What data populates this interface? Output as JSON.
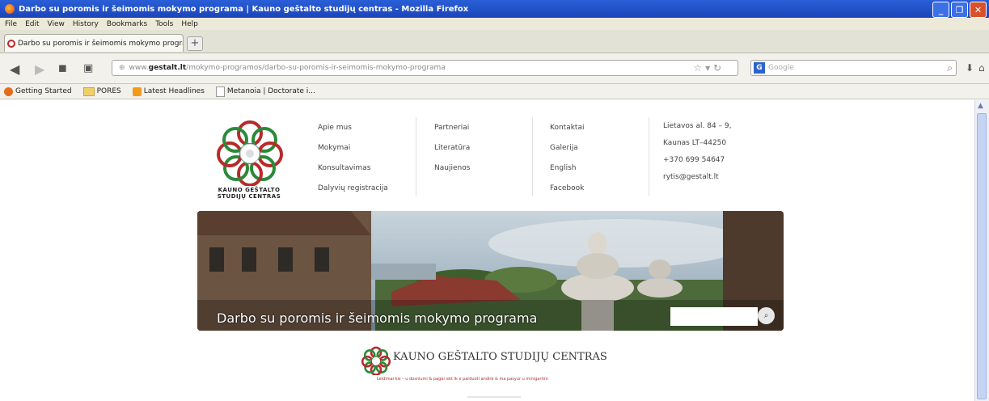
{
  "window": {
    "title": "Darbo su poromis ir šeimomis mokymo programa | Kauno geštalto studijų centras - Mozilla Firefox"
  },
  "menu": [
    "File",
    "Edit",
    "View",
    "History",
    "Bookmarks",
    "Tools",
    "Help"
  ],
  "tab": {
    "label": "Darbo su poromis ir šeimomis mokymo progra..."
  },
  "address": {
    "prefix": "www.",
    "domain": "gestalt.lt",
    "path": "/mokymo-programos/darbo-su-poromis-ir-seimomis-mokymo-programa"
  },
  "search": {
    "engine": "G",
    "placeholder": "Google"
  },
  "bookmarks": [
    "Getting Started",
    "PORES",
    "Latest Headlines",
    "Metanoia | Doctorate i..."
  ],
  "site": {
    "logo_line1": "KAUNO GEŠTALTO",
    "logo_line2": "STUDIJŲ CENTRAS",
    "nav_col1": [
      "Apie mus",
      "Mokymai",
      "Konsultavimas",
      "Dalyvių registracija"
    ],
    "nav_col2": [
      "Partneriai",
      "Literatūra",
      "Naujienos"
    ],
    "nav_col3": [
      "Kontaktai",
      "Galerija",
      "English",
      "Facebook"
    ],
    "contact": [
      "Lietavos al. 84 – 9,",
      "Kaunas LT–44250",
      "+370 699 54647",
      "rytis@gestalt.lt"
    ],
    "hero_title": "Darbo su poromis ir šeimomis mokymo programa",
    "footer_name": "KAUNO GEŠTALTO STUDIJŲ CENTRAS",
    "footer_note": "Leidimai kis – u dosniumi & pagar ekt lk e parduoti andire & ma pasyur u minigartim"
  },
  "colors": {
    "titlebar": "#2a5fd8",
    "accent_red": "#b82a2a",
    "accent_green": "#2a8a3a"
  }
}
